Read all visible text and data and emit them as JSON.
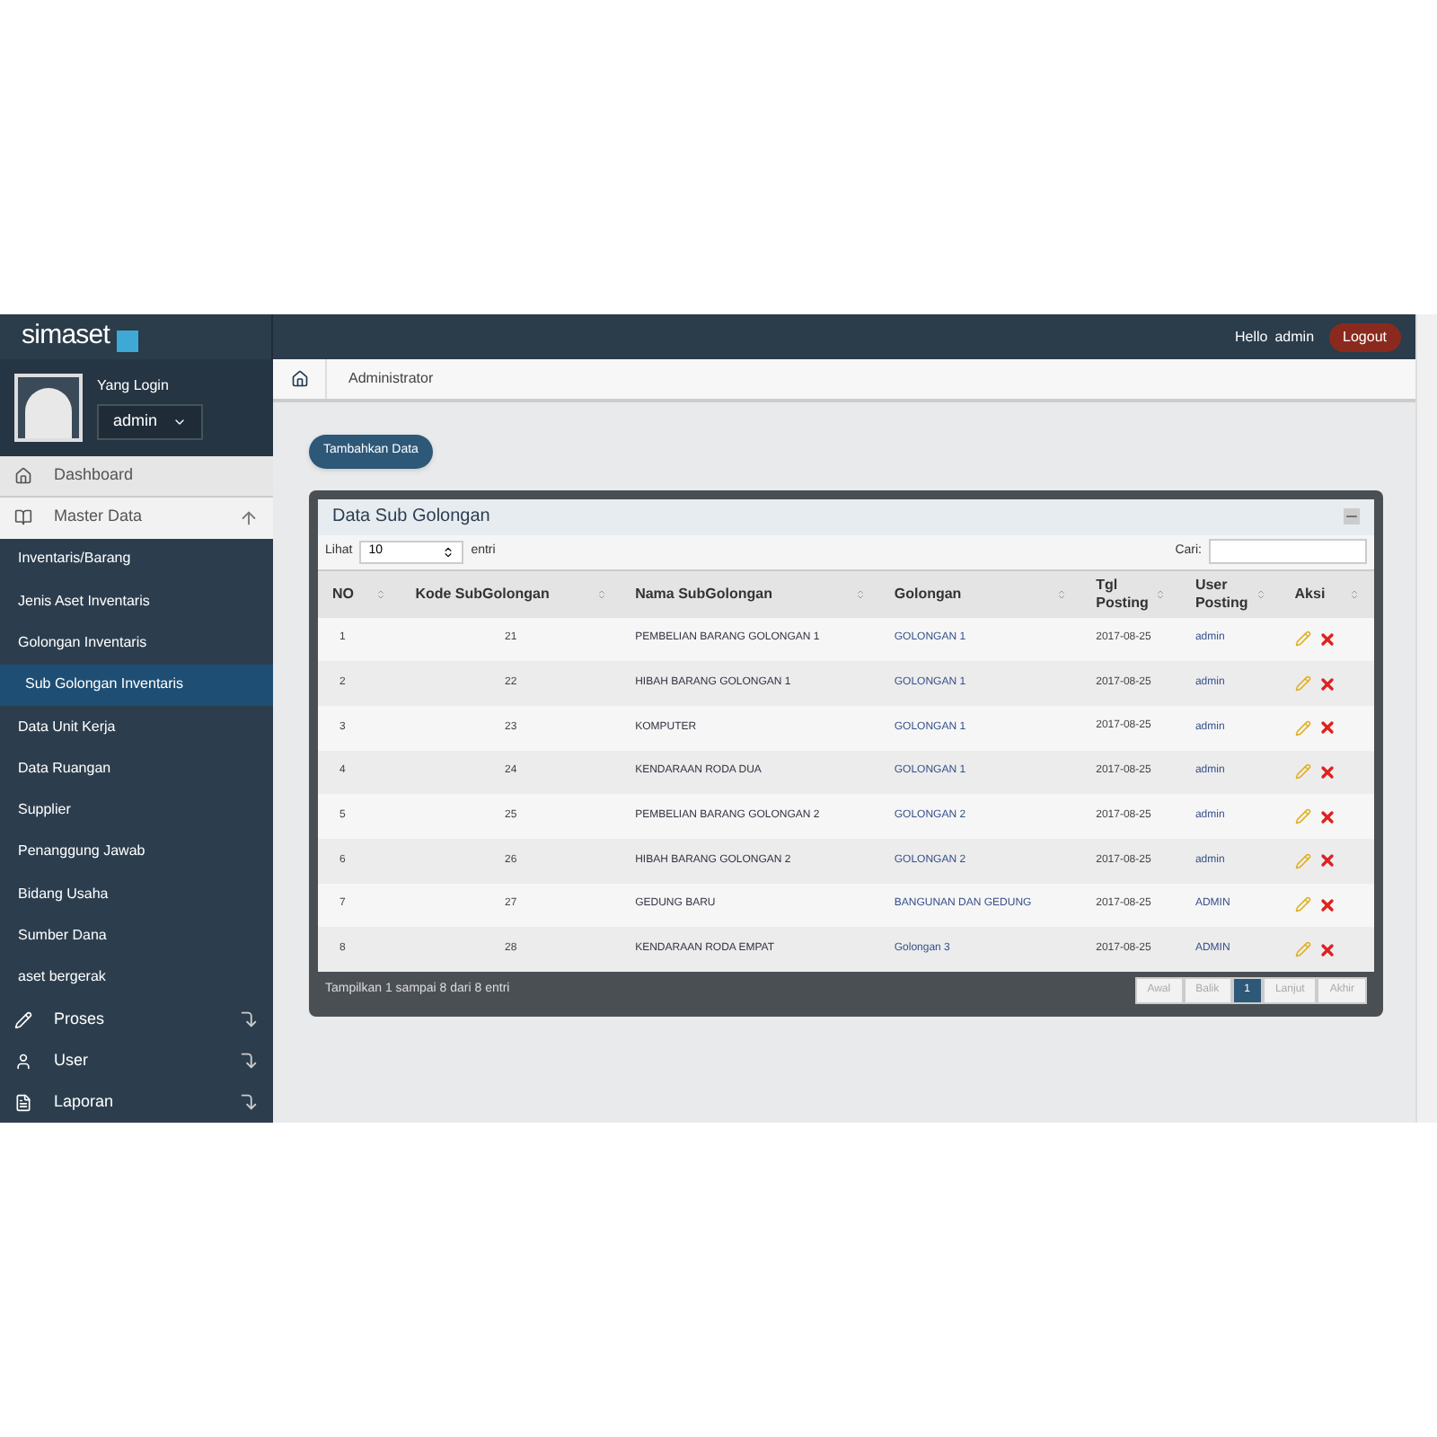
{
  "header": {
    "logo": "simaset",
    "greeting": "Hello",
    "user": "admin",
    "logout": "Logout"
  },
  "profile": {
    "label": "Yang Login",
    "user": "admin"
  },
  "sidebar": {
    "items": [
      {
        "label": "Dashboard",
        "kind": "main",
        "selected": false
      },
      {
        "label": "Master Data",
        "kind": "section",
        "expanded": true,
        "selected": false,
        "children": [
          {
            "label": "Inventaris/Barang",
            "selected": false
          },
          {
            "label": "Jenis Aset Inventaris",
            "selected": false
          },
          {
            "label": "Golongan Inventaris",
            "selected": false
          },
          {
            "label": "Sub Golongan Inventaris",
            "selected": true
          },
          {
            "label": "Data Unit Kerja",
            "selected": false
          },
          {
            "label": "Data Ruangan",
            "selected": false
          },
          {
            "label": "Supplier",
            "selected": false
          },
          {
            "label": "Penanggung Jawab",
            "selected": false
          },
          {
            "label": "Bidang Usaha",
            "selected": false
          },
          {
            "label": "Sumber Dana",
            "selected": false
          },
          {
            "label": "aset bergerak",
            "selected": false
          }
        ]
      },
      {
        "label": "Proses",
        "kind": "section",
        "expanded": false,
        "selected": false
      },
      {
        "label": "User",
        "kind": "section",
        "expanded": false,
        "selected": false
      },
      {
        "label": "Laporan",
        "kind": "section",
        "expanded": false,
        "selected": false
      }
    ]
  },
  "breadcrumb": "Administrator",
  "add_button": "Tambahkan Data",
  "panel": {
    "title": "Data Sub Golongan",
    "length_label": "Lihat",
    "length_value": "10",
    "length_suffix": "entri",
    "search_label": "Cari:",
    "columns": [
      "NO",
      "Kode SubGolongan",
      "Nama SubGolongan",
      "Golongan",
      "Tgl Posting",
      "User Posting",
      "Aksi"
    ],
    "rows": [
      {
        "no": "1",
        "kode": "21",
        "nama": "PEMBELIAN BARANG GOLONGAN 1",
        "golongan": "GOLONGAN 1",
        "tgl": "2017-08-25",
        "user": "admin"
      },
      {
        "no": "2",
        "kode": "22",
        "nama": "HIBAH BARANG GOLONGAN 1",
        "golongan": "GOLONGAN 1",
        "tgl": "2017-08-25",
        "user": "admin"
      },
      {
        "no": "3",
        "kode": "23",
        "nama": "KOMPUTER",
        "golongan": "GOLONGAN 1",
        "tgl": "2017-08-25",
        "user": "admin"
      },
      {
        "no": "4",
        "kode": "24",
        "nama": "KENDARAAN RODA DUA",
        "golongan": "GOLONGAN 1",
        "tgl": "2017-08-25",
        "user": "admin"
      },
      {
        "no": "5",
        "kode": "25",
        "nama": "PEMBELIAN BARANG GOLONGAN 2",
        "golongan": "GOLONGAN 2",
        "tgl": "2017-08-25",
        "user": "admin"
      },
      {
        "no": "6",
        "kode": "26",
        "nama": "HIBAH BARANG GOLONGAN 2",
        "golongan": "GOLONGAN 2",
        "tgl": "2017-08-25",
        "user": "admin"
      },
      {
        "no": "7",
        "kode": "27",
        "nama": "GEDUNG BARU",
        "golongan": "BANGUNAN DAN GEDUNG",
        "tgl": "2017-08-25",
        "user": "ADMIN"
      },
      {
        "no": "8",
        "kode": "28",
        "nama": "KENDARAAN RODA EMPAT",
        "golongan": "Golongan 3",
        "tgl": "2017-08-25",
        "user": "ADMIN"
      }
    ],
    "info": "Tampilkan 1 sampai 8 dari 8 entri",
    "pages": [
      {
        "label": "Awal",
        "selected": false,
        "disabled": true
      },
      {
        "label": "Balik",
        "selected": false,
        "disabled": true
      },
      {
        "label": "1",
        "selected": true,
        "disabled": false
      },
      {
        "label": "Lanjut",
        "selected": false,
        "disabled": true
      },
      {
        "label": "Akhir",
        "selected": false,
        "disabled": true
      }
    ]
  }
}
